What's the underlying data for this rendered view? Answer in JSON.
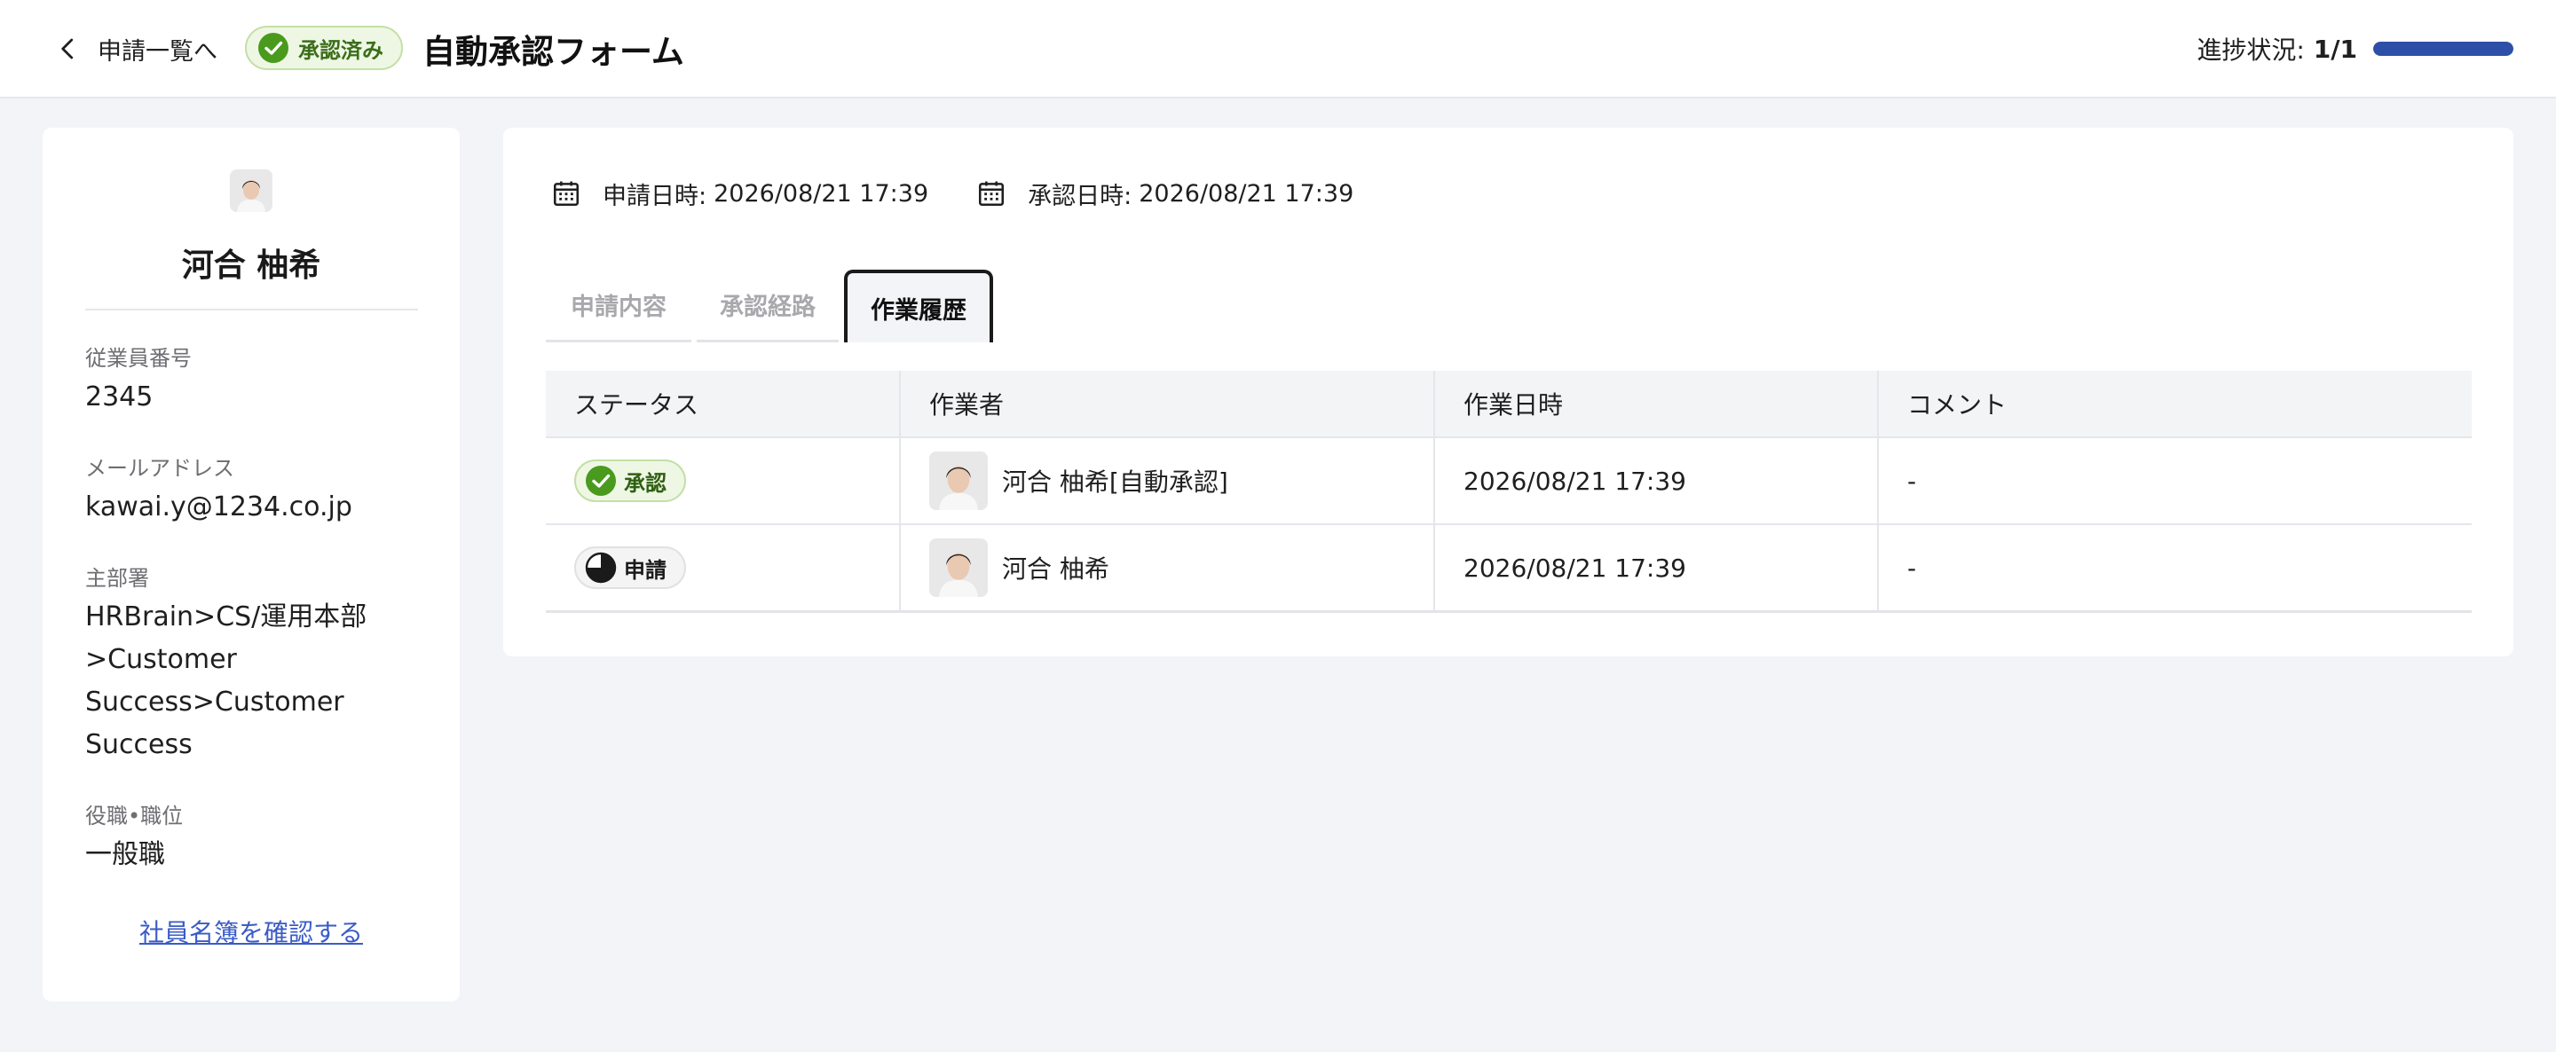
{
  "header": {
    "back_label": "申請一覧へ",
    "status_badge": "承認済み",
    "title": "自動承認フォーム",
    "progress_label": "進捗状況:",
    "progress_value": "1/1",
    "progress_fraction": 1.0,
    "progress_color": "#2e4fa8"
  },
  "profile": {
    "name": "河合 柚希",
    "fields": [
      {
        "label": "従業員番号",
        "value": "2345"
      },
      {
        "label": "メールアドレス",
        "value": "kawai.y@1234.co.jp"
      },
      {
        "label": "主部署",
        "value_lines": [
          "HRBrain>CS/運用本部",
          ">Customer",
          "Success>Customer",
          "Success"
        ]
      },
      {
        "label": "役職•職位",
        "value": "一般職"
      }
    ],
    "directory_link": "社員名簿を確認する"
  },
  "dates": {
    "applied_label": "申請日時:",
    "applied_value": "2026/08/21 17:39",
    "approved_label": "承認日時:",
    "approved_value": "2026/08/21 17:39"
  },
  "tabs": [
    {
      "label": "申請内容",
      "active": false
    },
    {
      "label": "承認経路",
      "active": false
    },
    {
      "label": "作業履歴",
      "active": true
    }
  ],
  "table": {
    "headers": [
      "ステータス",
      "作業者",
      "作業日時",
      "コメント"
    ],
    "rows": [
      {
        "status": "承認",
        "status_type": "approved",
        "worker": "河合 柚希[自動承認]",
        "datetime": "2026/08/21 17:39",
        "comment": "-"
      },
      {
        "status": "申請",
        "status_type": "applied",
        "worker": "河合 柚希",
        "datetime": "2026/08/21 17:39",
        "comment": "-"
      }
    ]
  },
  "colors": {
    "approved_green": "#4a9a1e",
    "link_blue": "#3a5bc7"
  }
}
